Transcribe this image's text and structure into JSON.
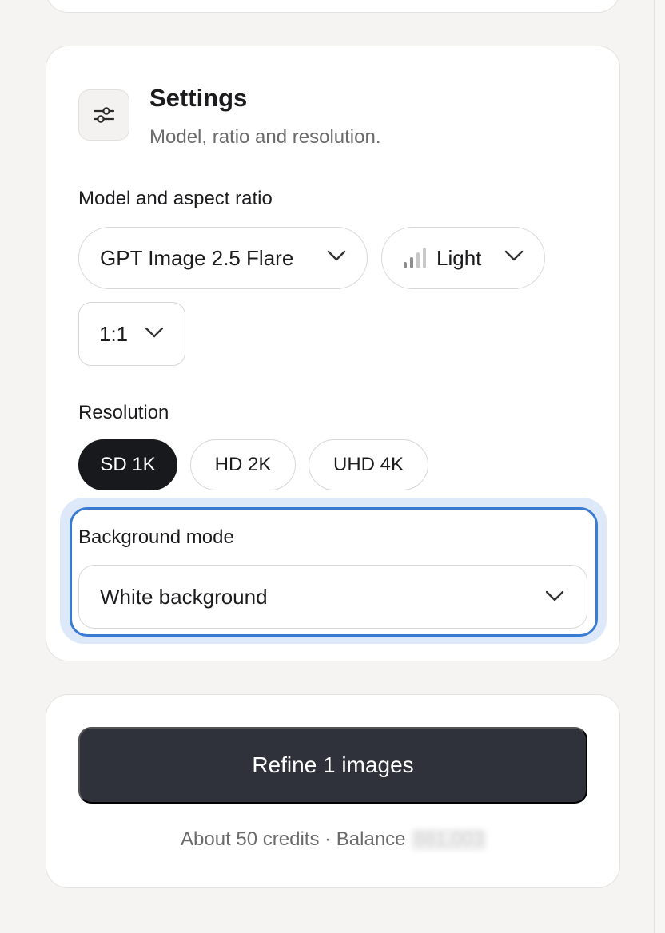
{
  "settings": {
    "title": "Settings",
    "subtitle": "Model, ratio and resolution.",
    "icon": "sliders-icon"
  },
  "model_ratio": {
    "label": "Model and aspect ratio",
    "model": "GPT Image 2.5 Flare",
    "quality": "Light",
    "quality_icon": "signal-bars-icon",
    "ratio": "1:1"
  },
  "resolution": {
    "label": "Resolution",
    "options": [
      "SD 1K",
      "HD 2K",
      "UHD 4K"
    ],
    "selected": "SD 1K"
  },
  "background": {
    "label": "Background mode",
    "value": "White background"
  },
  "action": {
    "button": "Refine 1 images",
    "credits_text": "About 50 credits · Balance",
    "balance_redacted": "881,003"
  },
  "colors": {
    "primary_button": "#2f323a",
    "active_chip": "#18191d",
    "focus_ring": "#3a7bd6",
    "focus_halo": "#dde8f9"
  }
}
